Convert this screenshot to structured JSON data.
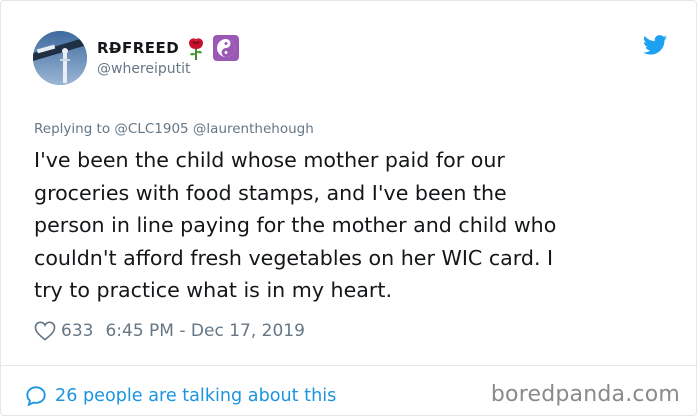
{
  "tweet": {
    "display_name": "RD̶FREED",
    "emojis": [
      "rose-icon",
      "yin-yang-icon"
    ],
    "handle": "@whereiputit",
    "replying_to": "Replying to @CLC1905 @laurenthehough",
    "text": "I've been the child whose mother paid for our\ngroceries with food stamps, and I've been the\nperson in line paying for the mother and child who\ncouldn't afford fresh vegetables on her WIC card. I\ntry to practice what is in my heart.",
    "like_count": "633",
    "timestamp": "6:45 PM - Dec 17, 2019",
    "talking": "26 people are talking about this"
  },
  "watermark": "boredpanda.com",
  "colors": {
    "twitter_blue": "#1da1f2",
    "link_blue": "#1b95e0",
    "secondary_text": "#657786",
    "divider": "#e1e8ed"
  }
}
